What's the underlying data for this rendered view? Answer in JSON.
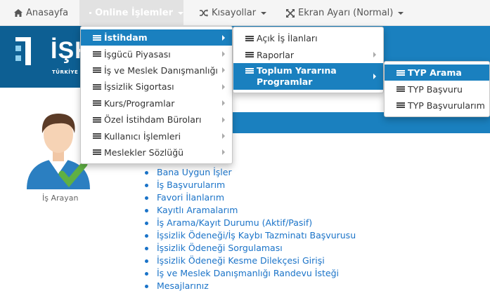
{
  "nav": {
    "home": "Anasayfa",
    "online": "Online İşlemler",
    "shortcuts": "Kısayollar",
    "screen": "Ekran Ayarı (Normal)"
  },
  "banner": {
    "logo_text": "İŞK",
    "logo_sub": "TÜRKİYE"
  },
  "profile": {
    "label": "İş Arayan"
  },
  "menu1": [
    "İstihdam",
    "İşgücü Piyasası",
    "İş ve Meslek Danışmanlığı",
    "İşsizlik Sigortası",
    "Kurs/Programlar",
    "Özel İstihdam Büroları",
    "Kullanıcı İşlemleri",
    "Meslekler Sözlüğü"
  ],
  "menu2": [
    "Açık İş İlanları",
    "Raporlar",
    "Toplum Yararına Programlar"
  ],
  "menu3": [
    "TYP Arama",
    "TYP Başvuru",
    "TYP Başvurularım"
  ],
  "links": [
    "Bana Uygun İşler",
    "İş Başvurularım",
    "Favori İlanlarım",
    "Kayıtlı Aramalarım",
    "İş Arama/Kayıt Durumu (Aktif/Pasif)",
    "İşsizlik Ödeneği/İş Kaybı Tazminatı Başvurusu",
    "İşsizlik Ödeneği Sorgulaması",
    "İşsizlik Ödeneği Kesme Dilekçesi Girişi",
    "İş ve Meslek Danışmanlığı Randevu İsteği",
    "Mesajlarınız"
  ],
  "colors": {
    "accent": "#1a80bf",
    "link": "#1a73c8"
  }
}
